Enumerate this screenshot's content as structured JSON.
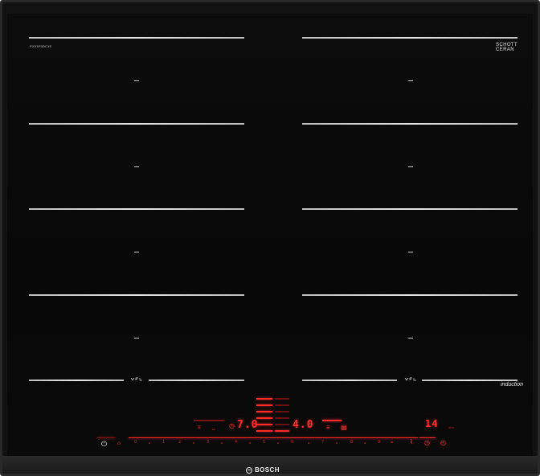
{
  "model_code": "PXX975DC1E",
  "brand_glass": {
    "line1": "SCHOTT",
    "line2": "CERAN"
  },
  "glass_subcode": "",
  "flex_badge_left": "",
  "flex_badge_right": "",
  "induction_label": "induction",
  "brand_name": "BOSCH",
  "displays": {
    "left_power": "7.0",
    "center_power": "4.0",
    "timer": "14"
  },
  "scale": [
    "0",
    "1",
    "2",
    "3",
    "4",
    "5",
    "6",
    "7",
    "8",
    "9"
  ],
  "colors": {
    "glass": "#0a0a0a",
    "frame": "#2a2a2a",
    "zone_lines": "#d9d9d9",
    "display_red": "#ff2f2f"
  },
  "icons": {
    "power": "power-icon",
    "child_lock": "lock-icon",
    "timer": "timer-icon",
    "clock": "clock-icon",
    "cooking_sensor": "sensor-icon",
    "boost": "boost-icon"
  }
}
